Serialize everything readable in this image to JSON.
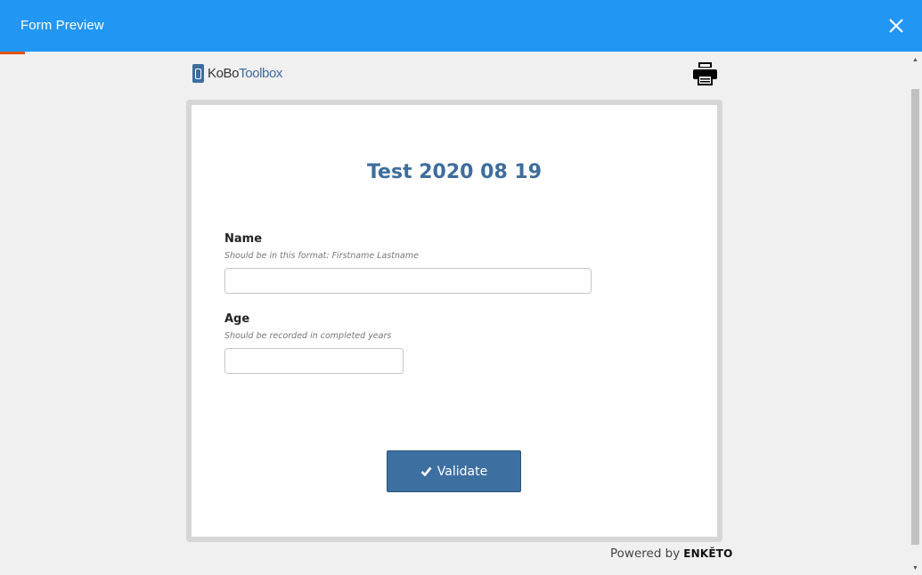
{
  "header": {
    "title": "Form Preview",
    "close_icon": "close-icon",
    "color": "#2196f3"
  },
  "branding": {
    "logo_text_a": "KoBo",
    "logo_text_b": "Toolbox",
    "print_icon": "printer-icon"
  },
  "form": {
    "title": "Test 2020 08 19",
    "title_color": "#3e6d9c",
    "questions": [
      {
        "label": "Name",
        "hint": "Should be in this format: Firstname Lastname",
        "value": "",
        "placeholder": ""
      },
      {
        "label": "Age",
        "hint": "Should be recorded in completed years",
        "value": "",
        "placeholder": ""
      }
    ],
    "validate_label": "Validate",
    "button_color": "#3e6fa1"
  },
  "footer": {
    "powered_by": "Powered by",
    "brand": "ENKĚTO"
  }
}
